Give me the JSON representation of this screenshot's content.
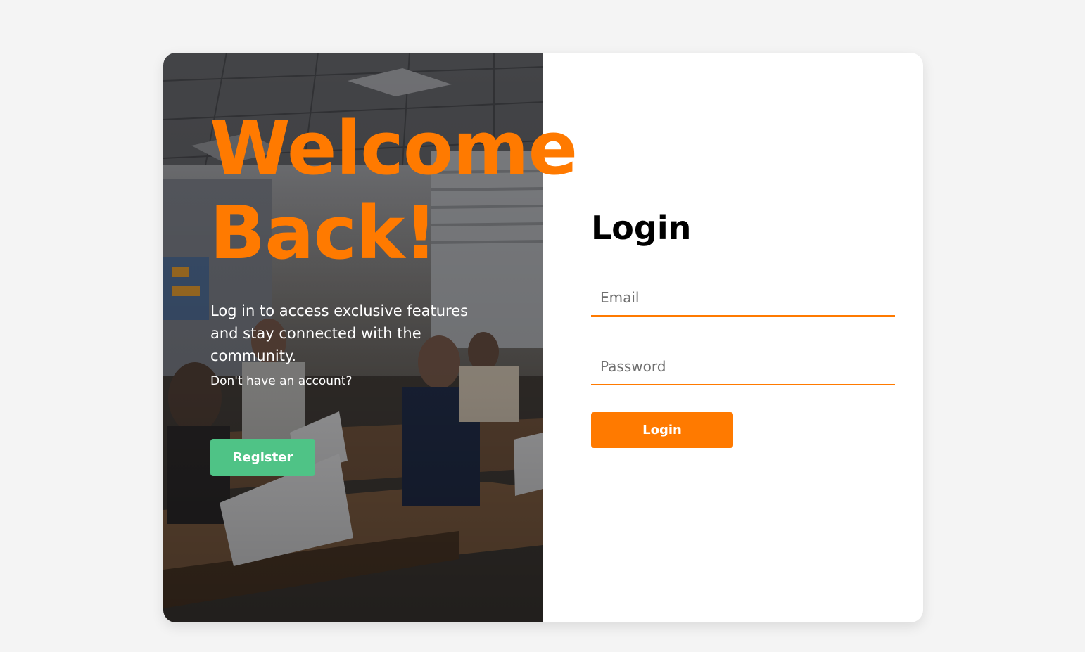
{
  "hero": {
    "title_line1": "Welcome",
    "title_line2": "Back!",
    "description": "Log in to access exclusive features and stay connected with the community.",
    "no_account": "Don't have an account?",
    "register_label": "Register",
    "background_image": "classroom-photo"
  },
  "login": {
    "title": "Login",
    "email_placeholder": "Email",
    "password_placeholder": "Password",
    "button_label": "Login"
  },
  "colors": {
    "accent": "#ff7a00",
    "register": "#4fc386",
    "page_background": "#f4f4f4",
    "card_background": "#ffffff"
  }
}
